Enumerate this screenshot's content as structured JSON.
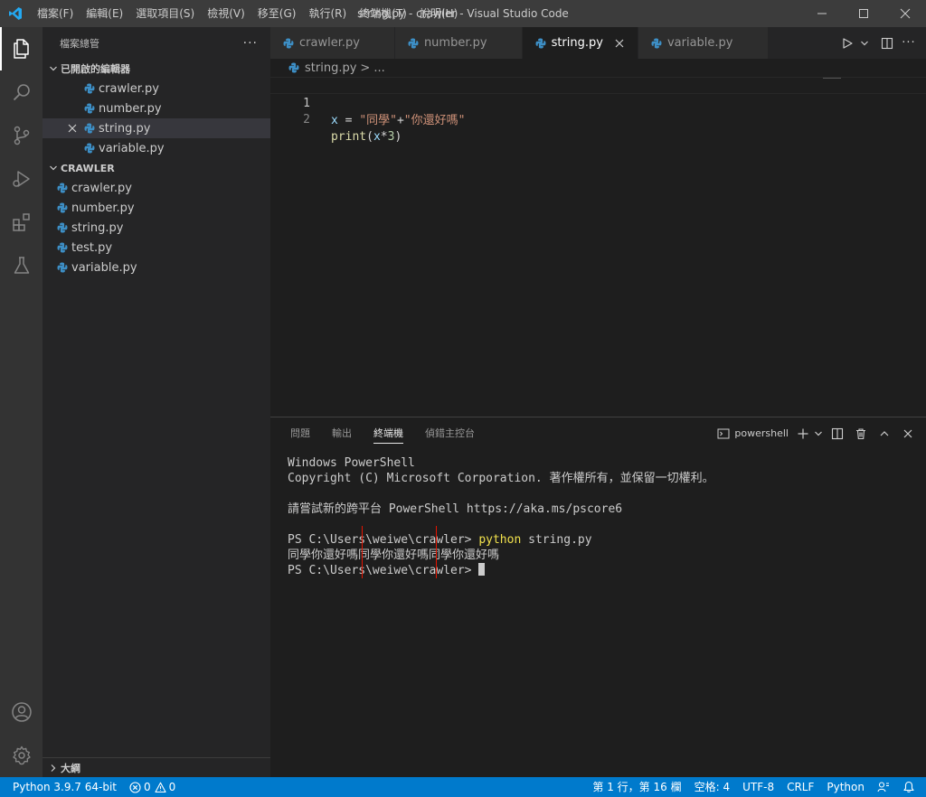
{
  "window": {
    "title": "string.py - crawler - Visual Studio Code"
  },
  "menu": [
    "檔案(F)",
    "編輯(E)",
    "選取項目(S)",
    "檢視(V)",
    "移至(G)",
    "執行(R)",
    "終端機(T)",
    "說明(H)"
  ],
  "sidebar": {
    "title": "檔案總管",
    "more": "···",
    "open_editors_label": "已開啟的編輯器",
    "open_editors": [
      {
        "name": "crawler.py"
      },
      {
        "name": "number.py"
      },
      {
        "name": "string.py"
      },
      {
        "name": "variable.py"
      }
    ],
    "workspace_label": "CRAWLER",
    "files": [
      {
        "name": "crawler.py"
      },
      {
        "name": "number.py"
      },
      {
        "name": "string.py"
      },
      {
        "name": "test.py"
      },
      {
        "name": "variable.py"
      }
    ],
    "outline_label": "大綱"
  },
  "tabs": [
    {
      "label": "crawler.py",
      "active": false
    },
    {
      "label": "number.py",
      "active": false
    },
    {
      "label": "string.py",
      "active": true
    },
    {
      "label": "variable.py",
      "active": false
    }
  ],
  "breadcrumb": {
    "file": "string.py",
    "sep": ">",
    "rest": "..."
  },
  "editor": {
    "lines": [
      {
        "number": "1",
        "tokens": [
          [
            "var",
            "x"
          ],
          [
            "op",
            " = "
          ],
          [
            "str",
            "\"同學\""
          ],
          [
            "op",
            "+"
          ],
          [
            "str",
            "\"你還好嗎\""
          ]
        ]
      },
      {
        "number": "2",
        "tokens": [
          [
            "fn",
            "print"
          ],
          [
            "op",
            "("
          ],
          [
            "var",
            "x"
          ],
          [
            "op",
            "*"
          ],
          [
            "num",
            "3"
          ],
          [
            "op",
            ")"
          ]
        ]
      }
    ]
  },
  "panel": {
    "tabs": [
      "問題",
      "輸出",
      "終端機",
      "偵錯主控台"
    ],
    "active_tab": "終端機",
    "shell": "powershell",
    "terminal": {
      "line1": "Windows PowerShell",
      "line2": "Copyright (C) Microsoft Corporation. 著作權所有，並保留一切權利。",
      "line3": "",
      "line4": "請嘗試新的跨平台 PowerShell https://aka.ms/pscore6",
      "line5": "",
      "prompt1": "PS C:\\Users\\weiwe\\crawler> ",
      "command": "python",
      "command_args": " string.py",
      "output": "同學你還好嗎同學你還好嗎同學你還好嗎",
      "prompt2": "PS C:\\Users\\weiwe\\crawler> "
    }
  },
  "statusbar": {
    "interpreter": "Python 3.9.7 64-bit",
    "errors": "0",
    "warnings": "0",
    "position": "第 1 行，第 16 欄",
    "indent": "空格: 4",
    "encoding": "UTF-8",
    "eol": "CRLF",
    "language": "Python"
  },
  "colors": {
    "accent": "#007acc",
    "python_icon": "#3d8fc6",
    "title_bar": "#3c3c3c"
  }
}
